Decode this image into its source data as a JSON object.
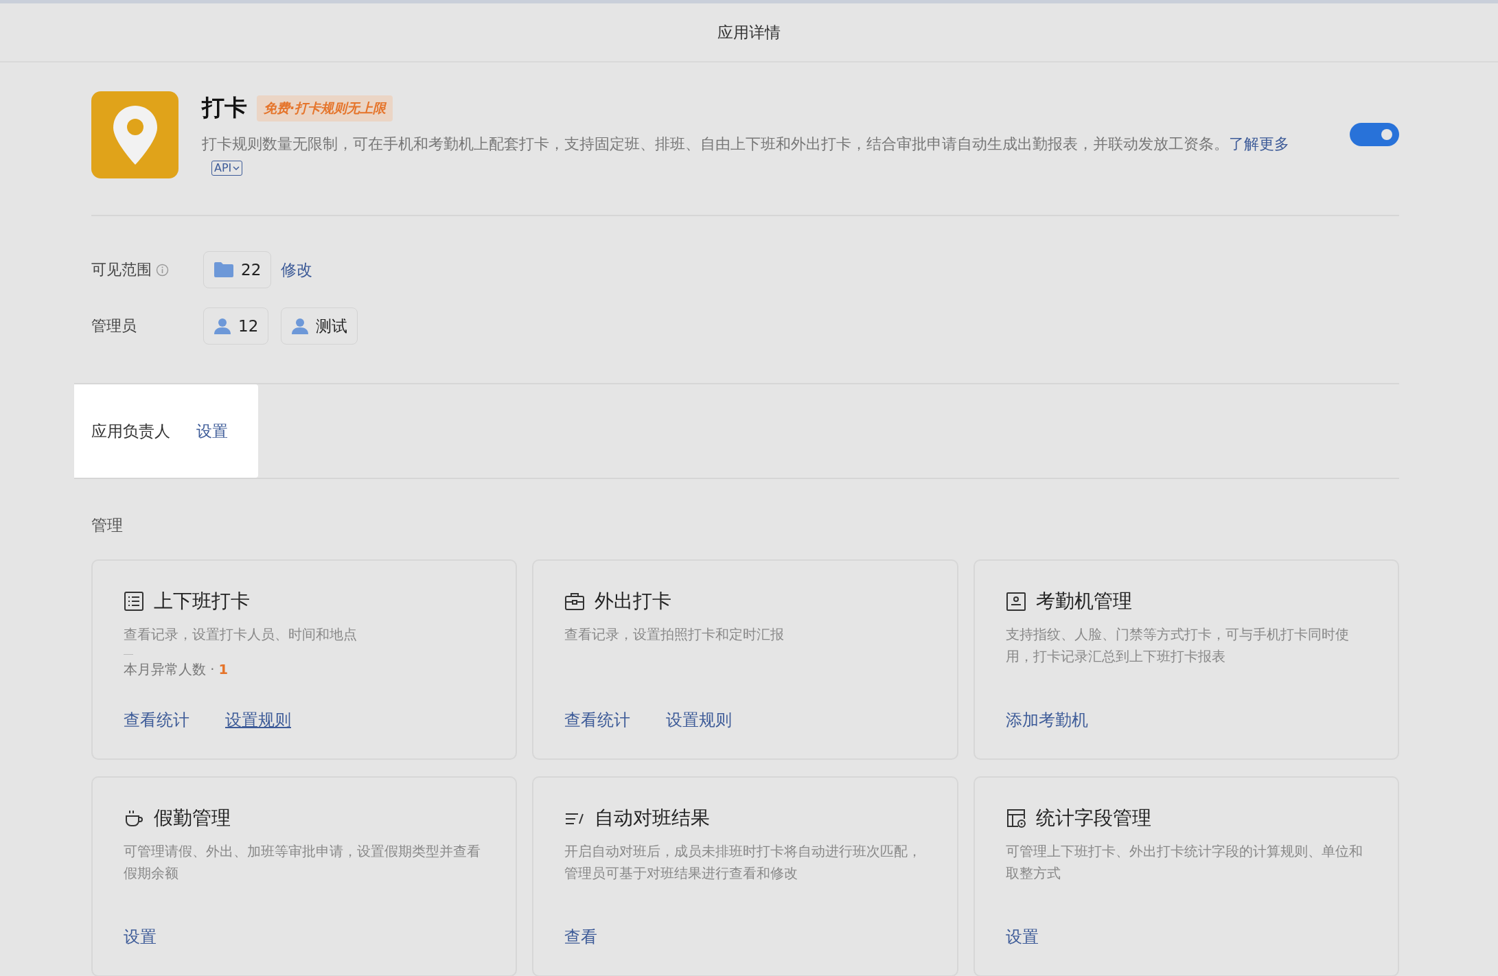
{
  "header": {
    "title": "应用详情"
  },
  "app": {
    "name": "打卡",
    "tag": "免费·打卡规则无上限",
    "description": "打卡规则数量无限制，可在手机和考勤机上配套打卡，支持固定班、排班、自由上下班和外出打卡，结合审批申请自动生成出勤报表，并联动发放工资条。",
    "learn_more": "了解更多",
    "api_badge": "API",
    "enabled": true
  },
  "visibility": {
    "label": "可见范围",
    "count": "22",
    "action": "修改"
  },
  "admins": {
    "label": "管理员",
    "chips": [
      {
        "text": "12"
      },
      {
        "text": "测试"
      }
    ]
  },
  "owner": {
    "label": "应用负责人",
    "action": "设置"
  },
  "manage": {
    "title": "管理",
    "cards": [
      {
        "title": "上下班打卡",
        "description": "查看记录，设置打卡人员、时间和地点",
        "stat_label": "本月异常人数 ·",
        "stat_value": "1",
        "links": [
          {
            "text": "查看统计",
            "underlined": false
          },
          {
            "text": "设置规则",
            "underlined": true
          }
        ]
      },
      {
        "title": "外出打卡",
        "description": "查看记录，设置拍照打卡和定时汇报",
        "links": [
          {
            "text": "查看统计",
            "underlined": false
          },
          {
            "text": "设置规则",
            "underlined": false
          }
        ]
      },
      {
        "title": "考勤机管理",
        "description": "支持指纹、人脸、门禁等方式打卡，可与手机打卡同时使用，打卡记录汇总到上下班打卡报表",
        "links": [
          {
            "text": "添加考勤机",
            "underlined": false
          }
        ]
      },
      {
        "title": "假勤管理",
        "description": "可管理请假、外出、加班等审批申请，设置假期类型并查看假期余额",
        "links": [
          {
            "text": "设置",
            "underlined": false
          }
        ]
      },
      {
        "title": "自动对班结果",
        "description": "开启自动对班后，成员未排班时打卡将自动进行班次匹配，管理员可基于对班结果进行查看和修改",
        "links": [
          {
            "text": "查看",
            "underlined": false
          }
        ]
      },
      {
        "title": "统计字段管理",
        "description": "可管理上下班打卡、外出打卡统计字段的计算规则、单位和取整方式",
        "links": [
          {
            "text": "设置",
            "underlined": false
          }
        ]
      }
    ]
  }
}
